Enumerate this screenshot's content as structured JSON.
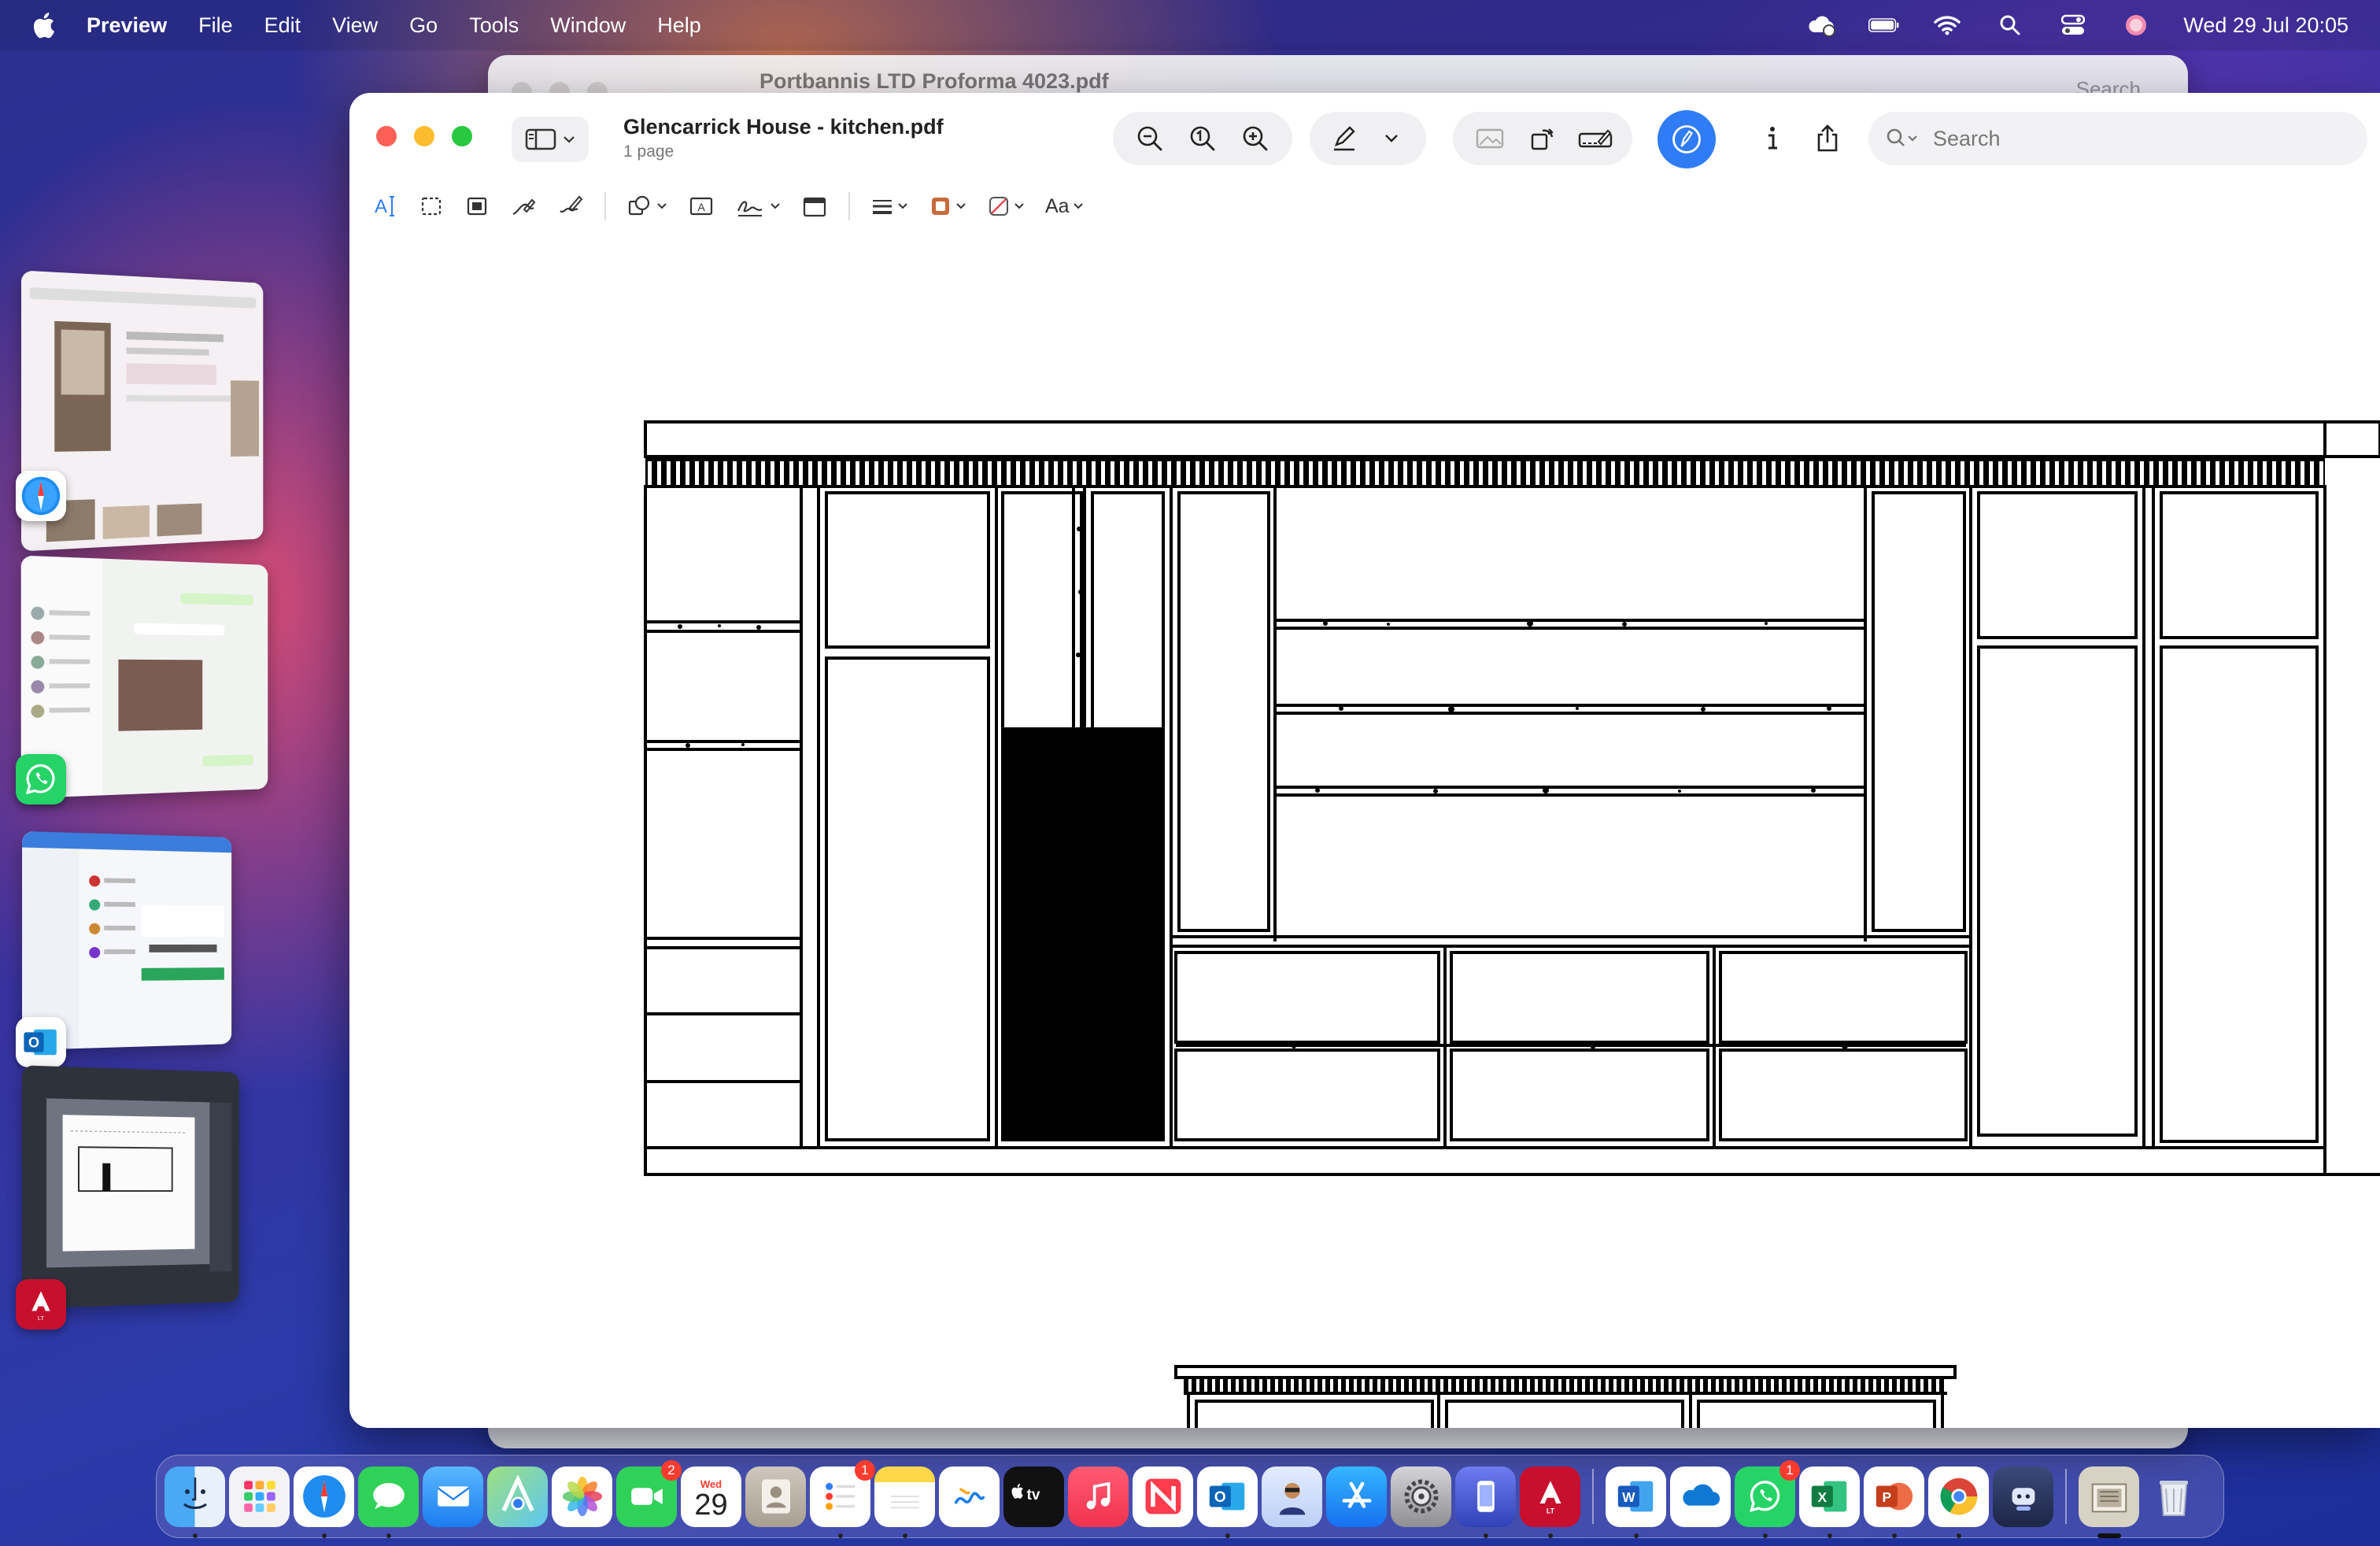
{
  "menubar": {
    "app_name": "Preview",
    "menus": [
      "File",
      "Edit",
      "View",
      "Go",
      "Tools",
      "Window",
      "Help"
    ],
    "datetime": "Wed 29 Jul  20:05"
  },
  "back_window": {
    "title": "Portbannis LTD  Proforma 4023.pdf",
    "search_placeholder": "Search"
  },
  "main_window": {
    "title": "Glencarrick House - kitchen.pdf",
    "subtitle": "1 page",
    "search_placeholder": "Search",
    "text_style_label": "Aa",
    "accent_color": "#2f7cf6"
  },
  "dock": {
    "calendar_month": "Wed",
    "calendar_day": "29",
    "facetime_badge": "2",
    "reminders_badge": "1",
    "whatsapp_badge": "1"
  }
}
